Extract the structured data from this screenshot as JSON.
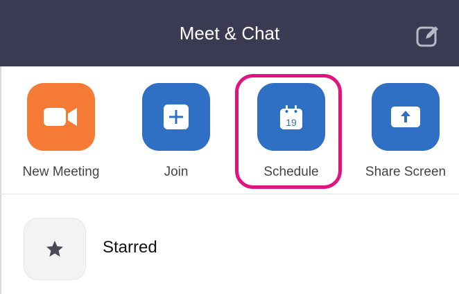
{
  "header": {
    "title": "Meet & Chat",
    "compose_icon": "compose-icon"
  },
  "actions": [
    {
      "label": "New Meeting",
      "icon": "video-camera-icon",
      "color": "#f47a35"
    },
    {
      "label": "Join",
      "icon": "plus-icon",
      "color": "#2f6fc4"
    },
    {
      "label": "Schedule",
      "icon": "calendar-icon",
      "calendar_day": "19",
      "color": "#2f6fc4"
    },
    {
      "label": "Share Screen",
      "icon": "share-screen-icon",
      "color": "#2f6fc4"
    }
  ],
  "starred": {
    "label": "Starred",
    "icon": "star-icon"
  },
  "highlight_color": "#e0147f"
}
